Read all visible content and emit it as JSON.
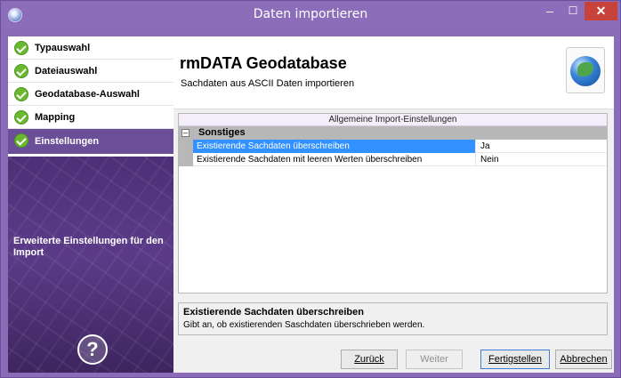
{
  "window": {
    "title": "Daten importieren"
  },
  "sidebar": {
    "steps": [
      {
        "label": "Typauswahl"
      },
      {
        "label": "Dateiauswahl"
      },
      {
        "label": "Geodatabase-Auswahl"
      },
      {
        "label": "Mapping"
      },
      {
        "label": "Einstellungen",
        "active": true
      }
    ],
    "description": "Erweiterte Einstellungen für den Import"
  },
  "header": {
    "title": "rmDATA Geodatabase",
    "subtitle": "Sachdaten aus ASCII Daten importieren"
  },
  "settings": {
    "caption": "Allgemeine Import-Einstellungen",
    "category": "Sonstiges",
    "rows": [
      {
        "name": "Existierende Sachdaten überschreiben",
        "value": "Ja"
      },
      {
        "name": "Existierende Sachdaten mit leeren Werten überschreiben",
        "value": "Nein"
      }
    ]
  },
  "description": {
    "title": "Existierende Sachdaten überschreiben",
    "text": "Gibt an, ob existierenden Saschdaten überschrieben werden."
  },
  "buttons": {
    "back": "Zurück",
    "next": "Weiter",
    "finish": "Fertigstellen",
    "cancel": "Abbrechen"
  }
}
